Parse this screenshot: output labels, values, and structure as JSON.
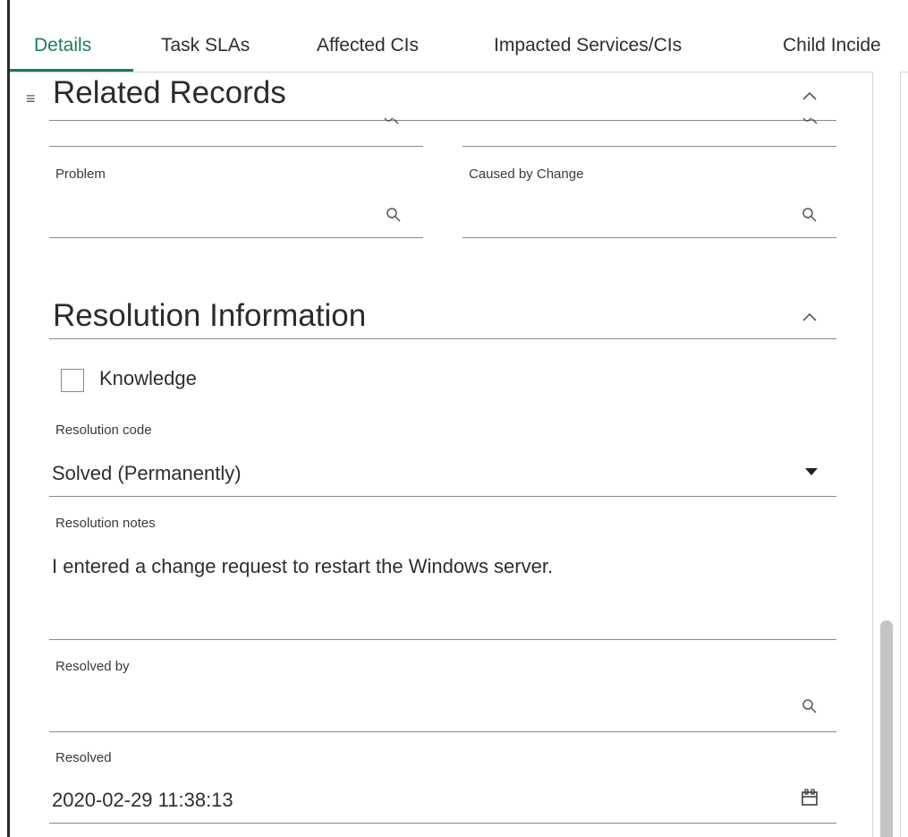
{
  "tabs": [
    "Details",
    "Task SLAs",
    "Affected CIs",
    "Impacted Services/CIs",
    "Child Incide"
  ],
  "related_records": {
    "title": "Related Records",
    "problem_label": "Problem",
    "caused_by_change_label": "Caused by Change"
  },
  "resolution": {
    "title": "Resolution Information",
    "knowledge_label": "Knowledge",
    "resolution_code_label": "Resolution code",
    "resolution_code_value": "Solved (Permanently)",
    "resolution_notes_label": "Resolution notes",
    "resolution_notes_value": "I entered a change request to restart the Windows server.",
    "resolved_by_label": "Resolved by",
    "resolved_label": "Resolved",
    "resolved_value": "2020-02-29 11:38:13"
  },
  "colors": {
    "accent": "#1e7a63"
  }
}
